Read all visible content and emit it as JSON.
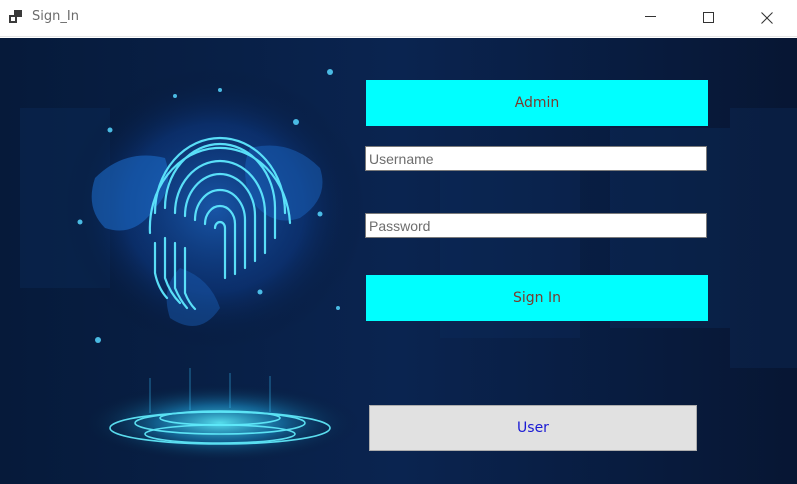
{
  "window": {
    "title": "Sign_In",
    "minimize_icon": "minimize-icon",
    "maximize_icon": "maximize-icon",
    "close_icon": "close-icon"
  },
  "form": {
    "admin_label": "Admin",
    "username_placeholder": "Username",
    "password_placeholder": "Password",
    "signin_label": "Sign In",
    "user_label": "User"
  },
  "colors": {
    "accent_button": "#00ffff",
    "button_text": "#7a3b2e",
    "user_button_text": "#1a1ad4",
    "background": "#05122a"
  }
}
